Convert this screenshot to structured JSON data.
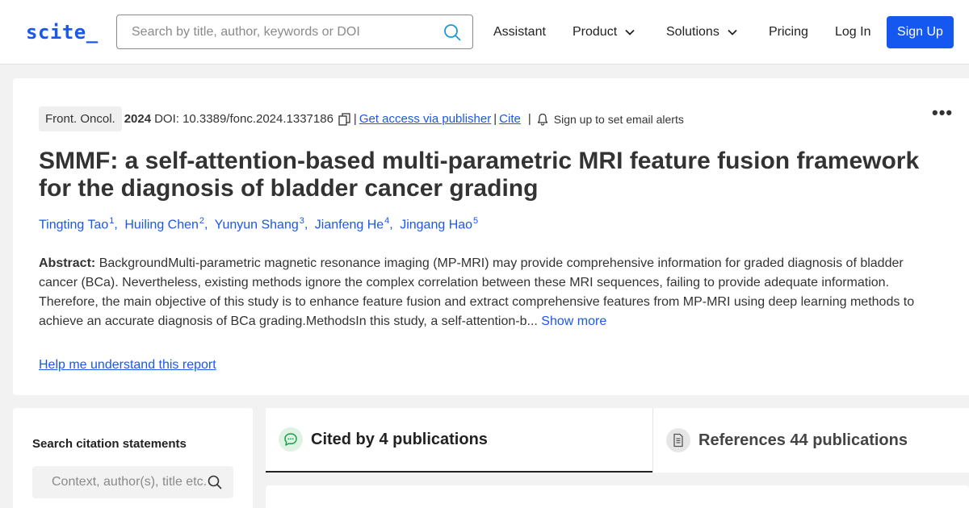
{
  "header": {
    "logo": "scite_",
    "search_placeholder": "Search by title, author, keywords or DOI",
    "nav": {
      "assistant": "Assistant",
      "product": "Product",
      "solutions": "Solutions",
      "pricing": "Pricing",
      "login": "Log In",
      "signup": "Sign Up"
    }
  },
  "paper": {
    "journal": "Front. Oncol.",
    "year": "2024",
    "doi": "DOI: 10.3389/fonc.2024.1337186",
    "access_link": "Get access via publisher",
    "cite_link": "Cite",
    "alerts_text": "Sign up to set email alerts",
    "title": "SMMF: a self-attention-based multi-parametric MRI feature fusion framework for the diagnosis of bladder cancer grading",
    "authors": [
      {
        "name": "Tingting Tao",
        "sup": "1"
      },
      {
        "name": "Huiling Chen",
        "sup": "2"
      },
      {
        "name": "Yunyun Shang",
        "sup": "3"
      },
      {
        "name": "Jianfeng He",
        "sup": "4"
      },
      {
        "name": "Jingang Hao",
        "sup": "5"
      }
    ],
    "abstract_label": "Abstract:",
    "abstract_text": "BackgroundMulti-parametric magnetic resonance imaging (MP-MRI) may provide comprehensive information for graded diagnosis of bladder cancer (BCa). Nevertheless, existing methods ignore the complex correlation between these MRI sequences, failing to provide adequate information. Therefore, the main objective of this study is to enhance feature fusion and extract comprehensive features from MP-MRI using deep learning methods to achieve an accurate diagnosis of BCa grading.MethodsIn this study, a self-attention-b...",
    "show_more": "Show more",
    "help_link": "Help me understand this report"
  },
  "sidebar": {
    "label": "Search citation statements",
    "search_placeholder": "Context, author(s), title etc."
  },
  "tabs": {
    "cited_by": "Cited by 4 publications",
    "references": "References 44 publications"
  },
  "colors": {
    "brand": "#1a56f0",
    "cited_icon_bg": "#dff3e4",
    "cited_icon_fg": "#1f9d4c",
    "ref_icon_bg": "#e6e6e6"
  }
}
